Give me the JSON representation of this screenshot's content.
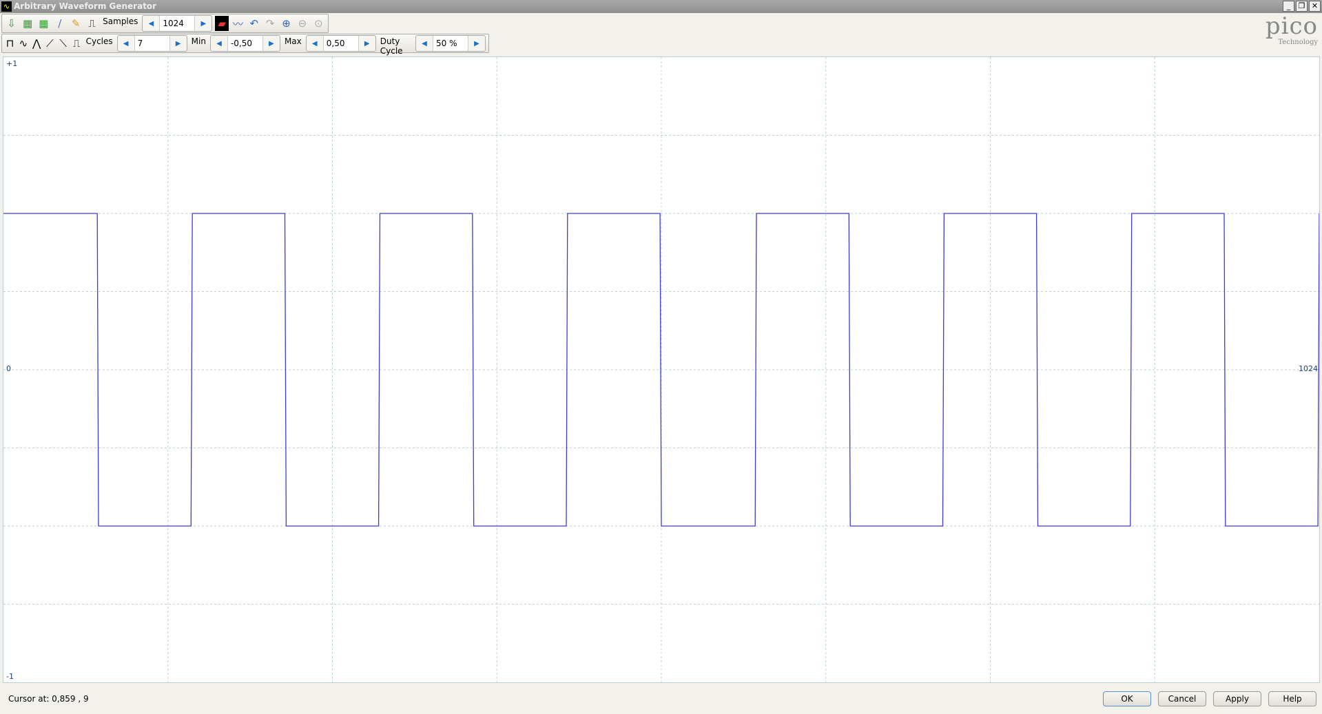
{
  "window": {
    "title": "Arbitrary Waveform Generator"
  },
  "toolbar1": {
    "samples_label": "Samples",
    "samples_value": "1024"
  },
  "toolbar2": {
    "cycles_label": "Cycles",
    "cycles_value": "7",
    "min_label": "Min",
    "min_value": "-0,50",
    "max_label": "Max",
    "max_value": "0,50",
    "duty_label": "Duty Cycle",
    "duty_value": "50 %"
  },
  "logo": {
    "brand": "pico",
    "tagline": "Technology"
  },
  "plot": {
    "y_top": "+1",
    "y_mid": "0",
    "y_bottom": "-1",
    "x_end": "1024",
    "grid_divisions_x": 8,
    "grid_divisions_y": 8,
    "line_color": "#3a3ae0"
  },
  "chart_data": {
    "type": "line",
    "waveform": "square",
    "samples": 1024,
    "cycles": 7,
    "min": -0.5,
    "max": 0.5,
    "duty_cycle": 0.5,
    "ylim": [
      -1,
      1
    ],
    "xlim": [
      0,
      1024
    ]
  },
  "status": {
    "cursor": "Cursor at: 0,859 , 9"
  },
  "buttons": {
    "ok": "OK",
    "cancel": "Cancel",
    "apply": "Apply",
    "help": "Help"
  }
}
